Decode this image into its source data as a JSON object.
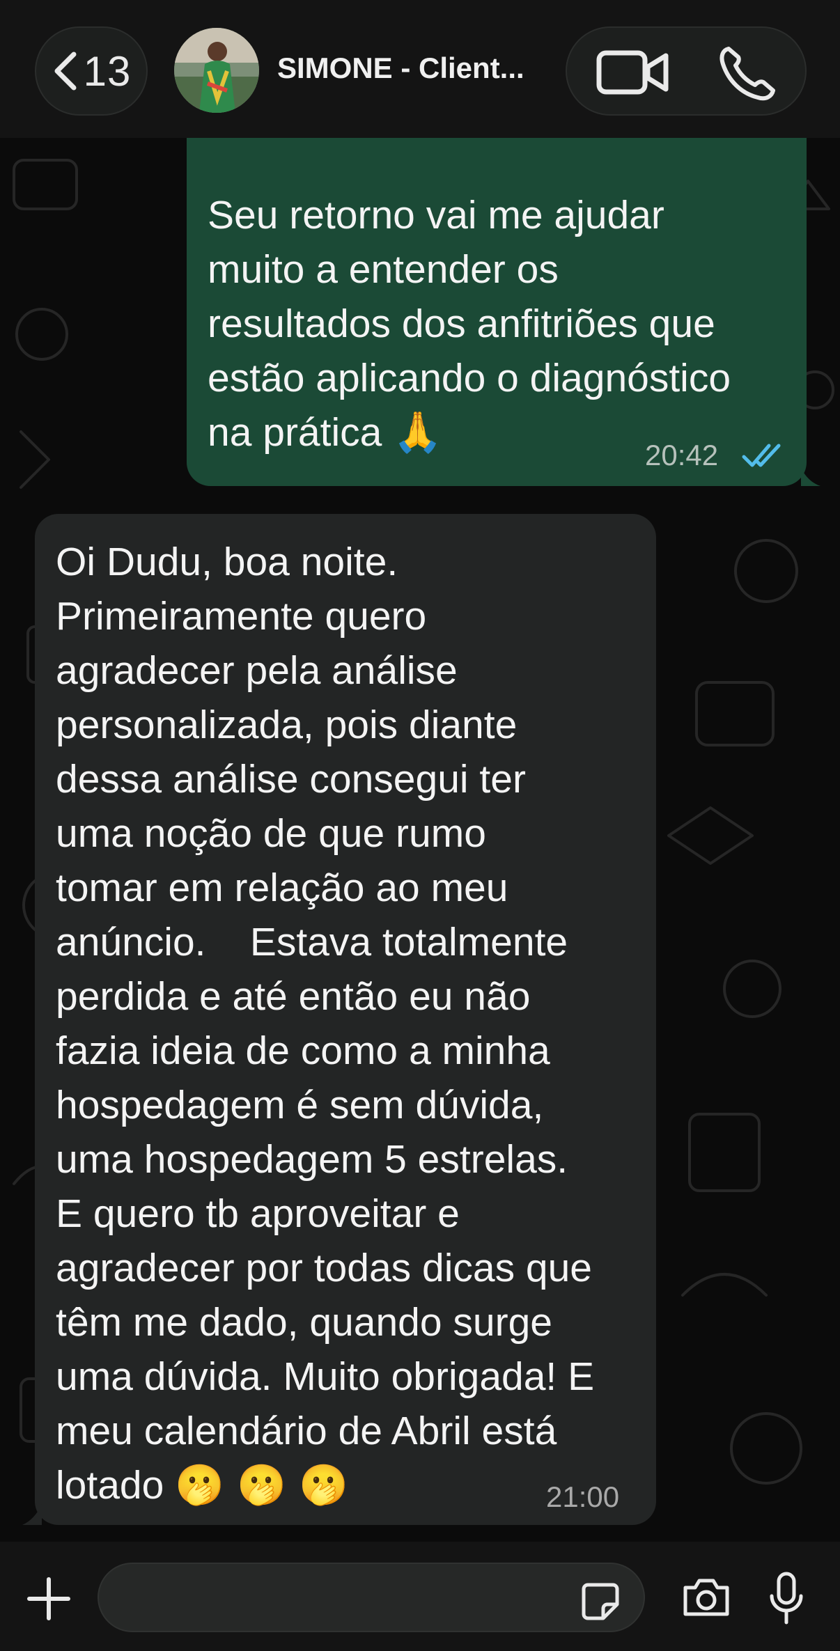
{
  "header": {
    "back_count": "13",
    "contact_name": "SIMONE - Client..."
  },
  "icons": {
    "back": "chevron-left-icon",
    "video": "video-camera-icon",
    "call": "phone-icon",
    "add": "plus-icon",
    "sticker": "sticker-icon",
    "camera": "camera-icon",
    "mic": "microphone-icon",
    "read_receipt": "double-check-icon"
  },
  "messages": [
    {
      "direction": "outgoing",
      "text": "Seu retorno vai me ajudar\nmuito a entender os\nresultados dos anfitriões que\nestão aplicando o diagnóstico\nna prática ",
      "emoji": "🙏",
      "time": "20:42",
      "status": "read"
    },
    {
      "direction": "incoming",
      "text": "Oi Dudu, boa noite.\nPrimeiramente quero\nagradecer pela análise\npersonalizada, pois diante\ndessa análise consegui ter\numa noção de que rumo\ntomar em relação ao meu\nanúncio.    Estava totalmente\nperdida e até então eu não\nfazia ideia de como a minha\nhospedagem é sem dúvida,\numa hospedagem 5 estrelas.\nE quero tb aproveitar e\nagradecer por todas dicas que\ntêm me dado, quando surge\numa dúvida. Muito obrigada! E\nmeu calendário de Abril está\nlotado ",
      "emoji": "🫢 🫢 🫢",
      "time": "21:00"
    }
  ],
  "composer": {
    "value": ""
  },
  "colors": {
    "outgoing_bubble": "#1b4a36",
    "incoming_bubble": "#232525",
    "read_tick": "#53bdeb",
    "background": "#0b0b0b"
  }
}
